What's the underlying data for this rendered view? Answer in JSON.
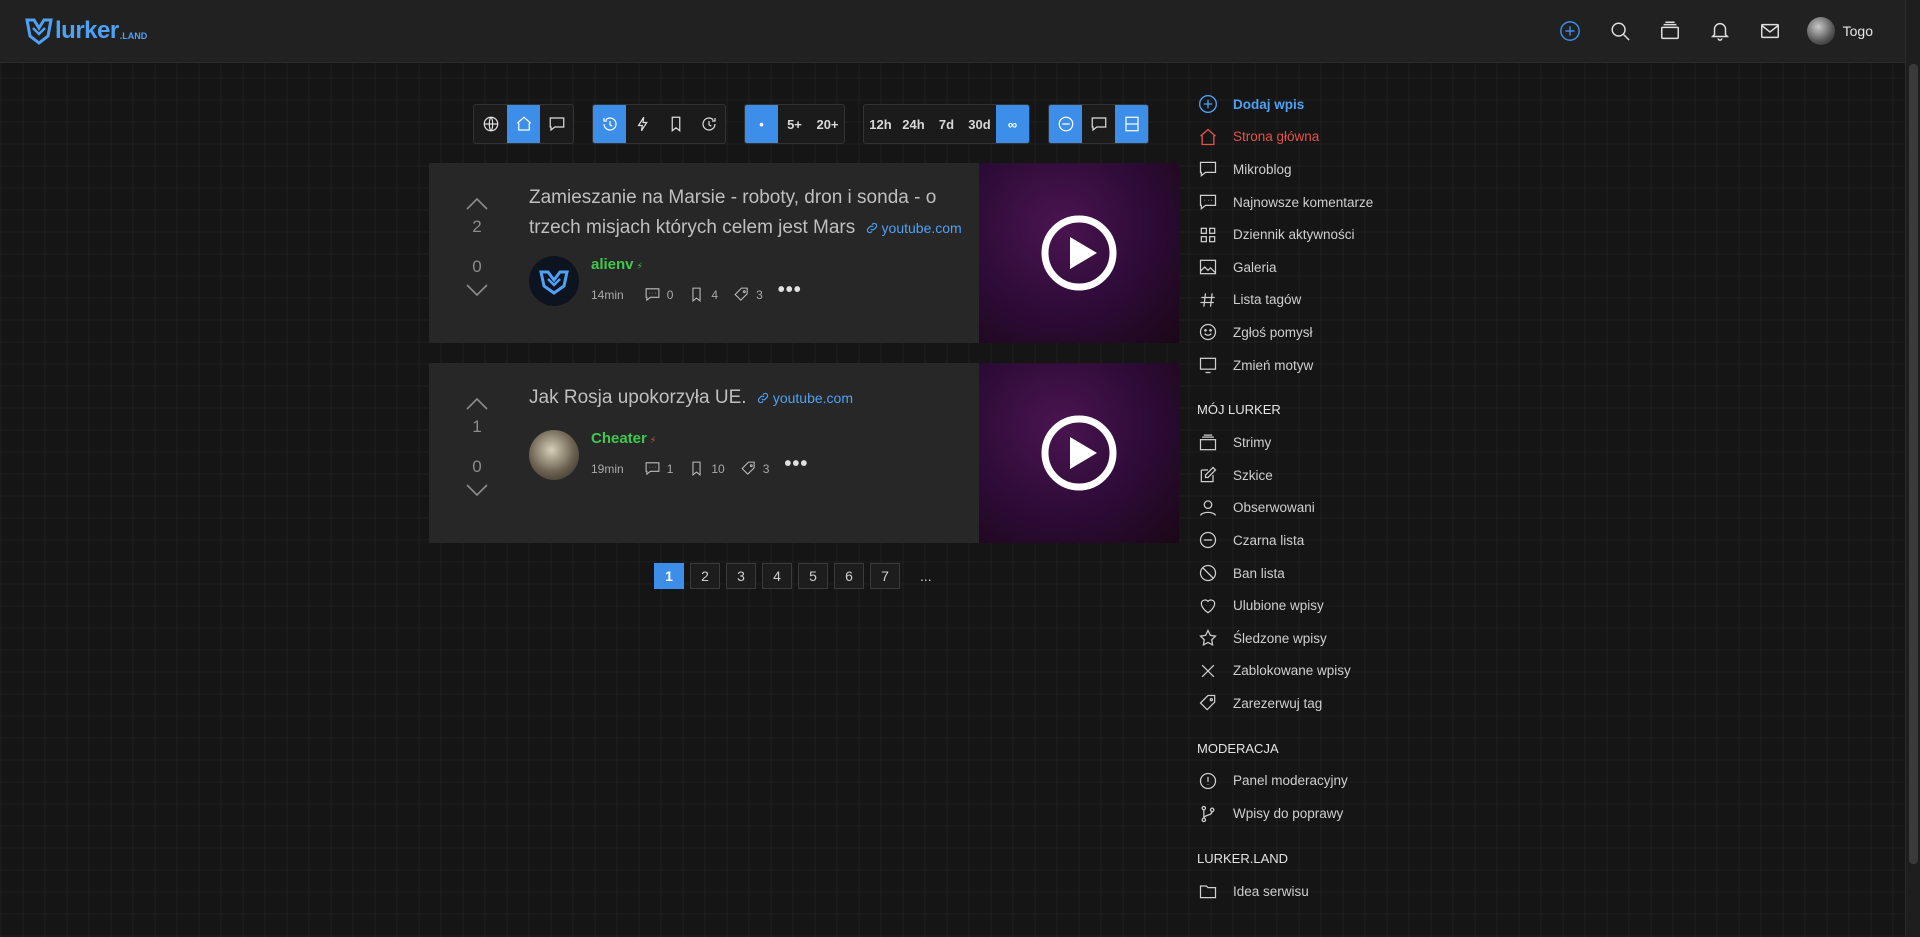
{
  "header": {
    "logo_text": "lurker",
    "logo_sub": ".LAND",
    "user_name": "Togo"
  },
  "filters": {
    "scope": [
      "globe-icon",
      "home-icon",
      "comment-icon"
    ],
    "sort": [
      "history-icon",
      "bolt-icon",
      "bookmark-icon",
      "clock-rotate-icon"
    ],
    "min_votes": [
      "•",
      "5+",
      "20+"
    ],
    "time_range": [
      "12h",
      "24h",
      "7d",
      "30d",
      "∞"
    ],
    "view": [
      "minus-circle-icon",
      "comment-icon",
      "layout-icon"
    ]
  },
  "posts": [
    {
      "upvotes": "2",
      "downvotes": "0",
      "title": "Zamieszanie na Marsie - roboty, dron i sonda - o trzech misjach których celem jest Mars",
      "source": "youtube.com",
      "author": "alienv",
      "time": "14min",
      "comments": "0",
      "bookmarks": "4",
      "tags": "3"
    },
    {
      "upvotes": "1",
      "downvotes": "0",
      "title": "Jak Rosja upokorzyła UE.",
      "source": "youtube.com",
      "author": "Cheater",
      "time": "19min",
      "comments": "1",
      "bookmarks": "10",
      "tags": "3"
    }
  ],
  "pagination": {
    "pages": [
      "1",
      "2",
      "3",
      "4",
      "5",
      "6",
      "7"
    ],
    "current": "1",
    "ellipsis": "..."
  },
  "sidebar": {
    "main": [
      {
        "label": "Dodaj wpis",
        "icon": "plus-circle-icon"
      },
      {
        "label": "Strona główna",
        "icon": "home-icon"
      },
      {
        "label": "Mikroblog",
        "icon": "comment-icon"
      },
      {
        "label": "Najnowsze komentarze",
        "icon": "comments-icon"
      },
      {
        "label": "Dziennik aktywności",
        "icon": "grid-icon"
      },
      {
        "label": "Galeria",
        "icon": "image-icon"
      },
      {
        "label": "Lista tagów",
        "icon": "hash-icon"
      },
      {
        "label": "Zgłoś pomysł",
        "icon": "smile-icon"
      },
      {
        "label": "Zmień motyw",
        "icon": "monitor-icon"
      }
    ],
    "my_heading": "MÓJ LURKER",
    "my": [
      {
        "label": "Strimy",
        "icon": "stack-icon"
      },
      {
        "label": "Szkice",
        "icon": "edit-icon"
      },
      {
        "label": "Obserwowani",
        "icon": "user-icon"
      },
      {
        "label": "Czarna lista",
        "icon": "minus-circle-icon"
      },
      {
        "label": "Ban lista",
        "icon": "ban-icon"
      },
      {
        "label": "Ulubione wpisy",
        "icon": "heart-icon"
      },
      {
        "label": "Śledzone wpisy",
        "icon": "star-icon"
      },
      {
        "label": "Zablokowane wpisy",
        "icon": "x-icon"
      },
      {
        "label": "Zarezerwuj tag",
        "icon": "tag-icon"
      }
    ],
    "mod_heading": "MODERACJA",
    "mod": [
      {
        "label": "Panel moderacyjny",
        "icon": "alert-circle-icon"
      },
      {
        "label": "Wpisy do poprawy",
        "icon": "git-branch-icon"
      }
    ],
    "site_heading": "LURKER.LAND",
    "site": [
      {
        "label": "Idea serwisu",
        "icon": "folder-icon"
      }
    ]
  },
  "colors": {
    "accent": "#3d8ee8",
    "link": "#4ea1f3",
    "author": "#3ec94d",
    "home": "#e2534b"
  }
}
